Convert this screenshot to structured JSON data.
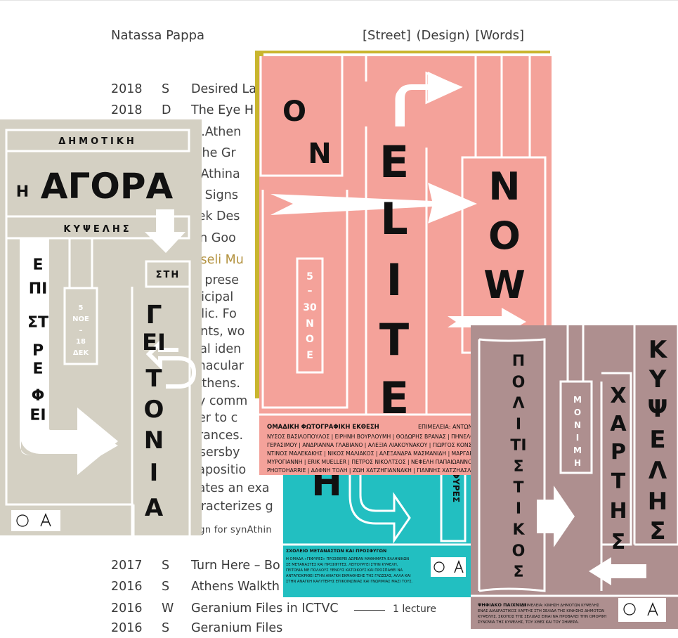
{
  "header": {
    "name": "Natassa Pappa",
    "nav": "[Street] (Design) [Words]"
  },
  "rows_top": [
    {
      "year": "2018",
      "type": "S",
      "title": "Desired La"
    },
    {
      "year": "2018",
      "type": "D",
      "title": "The Eye H"
    }
  ],
  "description": [
    "nd.Athen",
    "n the Gr",
    "ynAthina",
    "xit Signs",
    "reek Des",
    "ll in Goo",
    "ypseli Mu",
    "ne prese",
    "unicipal",
    "ublic. Fo",
    "vents, wo",
    "sual iden",
    "ernacular",
    "f Athens.",
    "ery comm",
    "rder to c",
    "ntrances.",
    "assersby",
    "xtapositio",
    "reates an exa",
    "haracterizes g",
    "esign for synAthin"
  ],
  "rows_bottom": [
    {
      "year": "2017",
      "type": "S",
      "title": "Turn Here – Bo",
      "note": ""
    },
    {
      "year": "2016",
      "type": "S",
      "title": "Athens Walkth",
      "note": ""
    },
    {
      "year": "2016",
      "type": "W",
      "title": "Geranium Files in ICTVC",
      "note": "1 lecture"
    },
    {
      "year": "2016",
      "type": "S",
      "title": "Geranium Files",
      "note": ""
    }
  ],
  "poster_agora": {
    "top_label": "ΔΗΜΟΤΙΚΗ",
    "eta": "Η",
    "title": "ΑΓΟΡΑ",
    "sub_label": "ΚΥΨΕΛΗΣ",
    "col_left": [
      "Ε",
      "ΠΙ",
      "ΣΤ",
      "Ρ",
      "Ε",
      "Φ",
      "ΕΙ"
    ],
    "dates": [
      "5",
      "ΝΟΕ",
      "–",
      "18",
      "ΔΕΚ"
    ],
    "sti": "ΣΤΗ",
    "col_right": [
      "Γ",
      "ΕΙ",
      "Τ",
      "Ο",
      "Ν",
      "Ι",
      "Α"
    ],
    "colors": {
      "bg": "#d4d0c3",
      "line": "#ffffff",
      "ink": "#111111"
    }
  },
  "poster_elite": {
    "on": [
      "O",
      "N"
    ],
    "elite": [
      "E",
      "L",
      "I",
      "T",
      "E"
    ],
    "now": [
      "N",
      "O",
      "W"
    ],
    "dates": [
      "5",
      "–",
      "30",
      "Ν",
      "Ο",
      "Ε"
    ],
    "footer_title": "ΟΜΑΔΙΚΗ ΦΩΤΟΓΡΑΦΙΚΗ ΕΚΘΕΣΗ",
    "footer_curator": "ΕΠΙΜΕΛΕΙΑ: ΑΝΤΩΝΑ",
    "footer_lines": [
      "ΝΥΣΟΣ ΒΑΣΙΛΟΠΟΥΛΟΣ | ΕΙΡΗΝΗ ΒΟΥΡΛΟΥΜΗ | ΘΟΔΩΡΗΣ ΒΡΑΝΑΣ | ΠΗΝΕΛΟ",
      "ΓΕΡΑΣΙΜΟΥ | ΑΝΔΡΙΑΝΝΑ ΓΛΑΒΙΑΝΟ | ΑΛΕΞΙΑ ΛΙΑΚΟΥΝΑΚΟΥ | ΓΙΩΡΓΟΣ ΚΟΝΣΤ",
      "ΝΤΙΝΟΣ ΜΑΛΕΚΑΚΗΣ | ΝΙΚΟΣ ΜΑΛΙΑΚΟΣ | ΑΛΕΞΑΝΔΡΑ ΜΑΣΜΑΝΙΔΗ | ΜΑΡΓΑΡ",
      "ΜΥΡΟΓΙΑΝΝΗ | ERIK MUELLER | ΠΕΤΡΟΣ ΝΙΚΟΛΤΣΟΣ | ΝΕΦΕΛΗ ΠΑΠΑΙΩΑΝΝΟ",
      "PHOTOHARRIE | ΔΑΦΝΗ ΤΟΛΗ | ΖΩΗ ΧΑΤΖΗΓΙΑΝΝΑΚΗ | ΓΙΑΝΝΗΣ ΧΑΤΖΗΑΣΛΑΝΙ"
    ],
    "colors": {
      "bg": "#f4a29a",
      "line": "#ffffff",
      "ink": "#111111",
      "accent": "#c9b52e"
    }
  },
  "poster_gefyres": {
    "big": "Η",
    "vertical": "ΦΥΡΕΣ",
    "title": "ΣΧΟΛΕΙΟ ΜΕΤΑΝΑΣΤΩΝ ΚΑΙ ΠΡΟΣΦΥΓΩΝ",
    "body": [
      "Η ΟΜΑΔΑ «ΓΕΦΥΡΕΣ» ΠΡΟΣΦΕΡΕΙ ΔΩΡΕΑΝ ΜΑΘΗΜΑΤΑ ΕΛΛΗΝΙΚΩΝ",
      "ΣΕ ΜΕΤΑΝΑΣΤΕΣ ΚΑΙ ΠΡΟΣΦΥΓΕΣ. ΛΕΙΤΟΥΡΓΕΙ ΣΤΗΝ ΚΥΨΕΛΗ,",
      "ΓΕΙΤΟΝΙΑ ΜΕ ΠΟΛΛΟΥΣ ΞΕΝΟΥΣ ΚΑΤΟΙΚΟΥΣ ΚΑΙ ΠΡΟΣΠΑΘΕΙ ΝΑ",
      "ΑΝΤΑΠΟΚΡΙΘΕΙ ΣΤΗΝ ΑΝΑΓΚΗ ΕΚΜΑΘΗΣΗΣ ΤΗΣ ΓΛΩΣΣΑΣ, ΑΛΛΑ ΚΑΙ",
      "ΣΤΗΝ ΑΝΑΓΚΗ ΚΑΛΥΤΕΡΗΣ ΕΠΙΚΟΙΝΩΝΙΑΣ ΚΑΙ ΓΝΩΡΙΜΙΑΣ ΜΑΖΙ ΤΟΥΣ."
    ],
    "colors": {
      "bg": "#22bfc1",
      "line": "#ffffff",
      "ink": "#111111"
    }
  },
  "poster_kypselis": {
    "col1": [
      "Π",
      "Ο",
      "Λ",
      "Ι",
      "ΤΙ",
      "Σ",
      "Τ",
      "Ι",
      "Κ",
      "Ο",
      "Σ"
    ],
    "col2": [
      "Μ",
      "Ο",
      "Ν",
      "Ι",
      "Μ",
      "Η"
    ],
    "col3": [
      "Χ",
      "Α",
      "Ρ",
      "Τ",
      "Η",
      "Σ"
    ],
    "col4": [
      "Κ",
      "Υ",
      "Ψ",
      "Ε",
      "Λ",
      "Η",
      "Σ"
    ],
    "footer_title": "ΨΗΦΙΑΚΟ ΠΑΙΧΝΙΔΙ",
    "footer_body": [
      "ΕΠΙΜΕΛΕΙΑ: ΚΙΝΗΣΗ ΔΗΜΟΤΩΝ ΚΥΨΕΛΗΣ",
      "ΕΝΑΣ ΔΙΑΔΡΑΣΤΙΚΟΣ ΧΑΡΤΗΣ ΣΤΗ ΣΕΛΙΔΑ ΤΗΣ ΚΙΝΗΣΗΣ ΔΗΜΟΤΩΝ",
      "ΚΥΨΕΛΗΣ. ΣΚΟΠΟΣ ΤΗΣ ΣΕΛΙΔΑΣ ΕΙΝΑΙ ΝΑ ΠΡΟΒΑΛΕΙ ΤΗΝ ΟΜΟΡΦΗ",
      "ΣΥΝΟΨΙΑ ΤΗΣ ΚΥΨΕΛΗΣ, ΤΟΥ ΧΘΕΣ ΚΑΙ ΤΟΥ ΣΗΜΕΡΑ."
    ],
    "colors": {
      "bg": "#ae8f8f",
      "line": "#ffffff",
      "ink": "#111111"
    }
  }
}
